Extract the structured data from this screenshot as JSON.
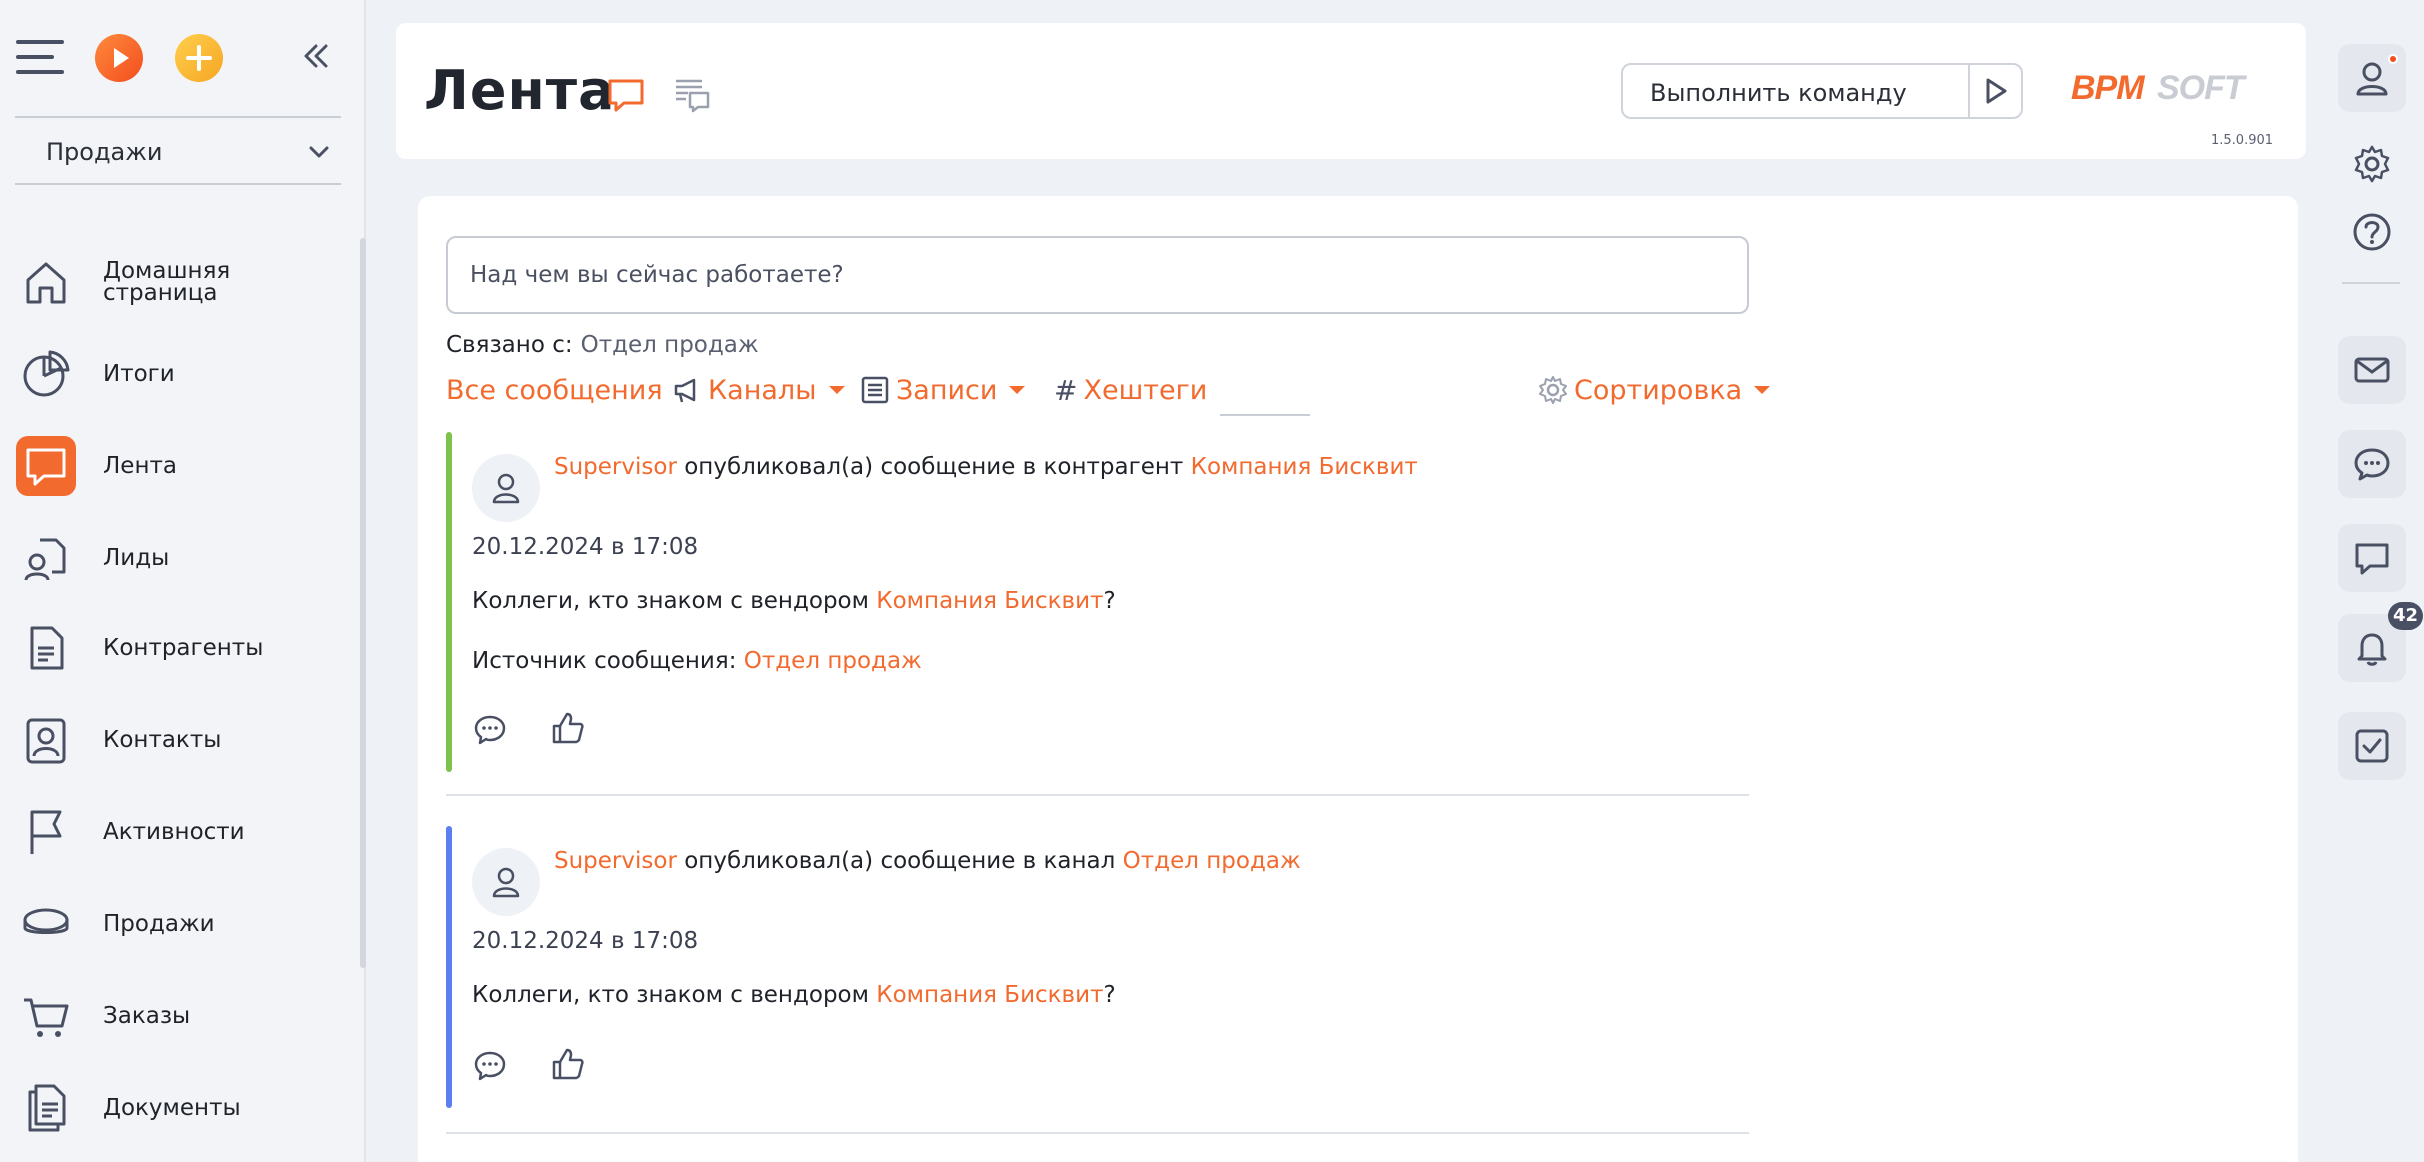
{
  "sidebar": {
    "workspace": "Продажи",
    "items": [
      {
        "label": "Домашняя страница",
        "icon": "home-icon"
      },
      {
        "label": "Итоги",
        "icon": "pie-chart-icon"
      },
      {
        "label": "Лента",
        "icon": "chat-bubble-icon",
        "active": true
      },
      {
        "label": "Лиды",
        "icon": "leads-icon"
      },
      {
        "label": "Контрагенты",
        "icon": "document-icon"
      },
      {
        "label": "Контакты",
        "icon": "contact-card-icon"
      },
      {
        "label": "Активности",
        "icon": "flag-icon"
      },
      {
        "label": "Продажи",
        "icon": "coins-icon"
      },
      {
        "label": "Заказы",
        "icon": "cart-icon"
      },
      {
        "label": "Документы",
        "icon": "documents-icon"
      }
    ]
  },
  "header": {
    "title": "Лента",
    "command_placeholder": "Выполнить команду",
    "logo_text": "BPMSOFT",
    "version": "1.5.0.901"
  },
  "rail": {
    "notifications_count": "42"
  },
  "feed": {
    "post_placeholder": "Над чем вы сейчас работаете?",
    "related_label": "Связано с:",
    "related_value": "Отдел продаж",
    "filters": {
      "all": "Все сообщения",
      "channels": "Каналы",
      "records": "Записи",
      "hashtags": "Хештеги",
      "sort": "Сортировка"
    },
    "posts": [
      {
        "author": "Supervisor",
        "action": "опубликовал(а) сообщение в контрагент",
        "target": "Компания Бисквит",
        "date": "20.12.2024 в 17:08",
        "text_before": "Коллеги, кто знаком с вендором",
        "text_link": "Компания Бисквит",
        "text_after": "?",
        "source_label": "Источник сообщения:",
        "source_value": "Отдел продаж",
        "accent": "#7dc24b"
      },
      {
        "author": "Supervisor",
        "action": "опубликовал(а) сообщение в канал",
        "target": "Отдел продаж",
        "date": "20.12.2024 в 17:08",
        "text_before": "Коллеги, кто знаком с вендором",
        "text_link": "Компания Бисквит",
        "text_after": "?",
        "accent": "#5b7ff0"
      }
    ]
  },
  "colors": {
    "accent": "#f26a2e",
    "text": "#1f2329",
    "icon": "#4a5063"
  }
}
